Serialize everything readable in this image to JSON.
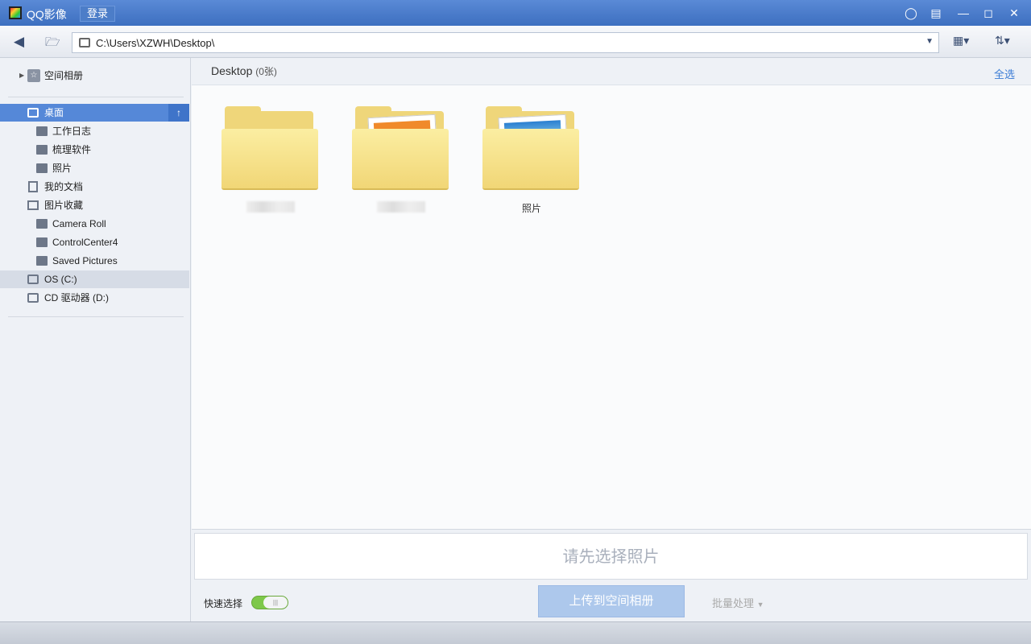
{
  "titlebar": {
    "app_title": "QQ影像",
    "login_label": "登录",
    "icons": [
      "feedback-icon",
      "menu-icon",
      "minimize-icon",
      "maximize-icon",
      "close-icon"
    ]
  },
  "toolbar": {
    "address": "C:\\Users\\XZWH\\Desktop\\"
  },
  "sidebar": {
    "cloud_album": "空间相册",
    "items": [
      {
        "label": "桌面"
      },
      {
        "label": "工作日志"
      },
      {
        "label": "梳理软件"
      },
      {
        "label": "照片"
      },
      {
        "label": "我的文档"
      },
      {
        "label": "图片收藏"
      },
      {
        "label": "Camera Roll"
      },
      {
        "label": "ControlCenter4"
      },
      {
        "label": "Saved Pictures"
      },
      {
        "label": "OS (C:)"
      },
      {
        "label": "CD 驱动器 (D:)"
      }
    ]
  },
  "main": {
    "folder_title": "Desktop",
    "count": "(0张)",
    "select_all": "全选",
    "folders": [
      {
        "name": ""
      },
      {
        "name": ""
      },
      {
        "name": "照片"
      }
    ]
  },
  "bottom": {
    "hint": "请先选择照片",
    "quick_select": "快速选择",
    "quick_select_on": true,
    "upload": "上传到空间相册",
    "batch": "批量处理"
  },
  "colors": {
    "titlebar": "#4a7bc8",
    "selection": "#5588d8",
    "toggle": "#7ec84a"
  }
}
